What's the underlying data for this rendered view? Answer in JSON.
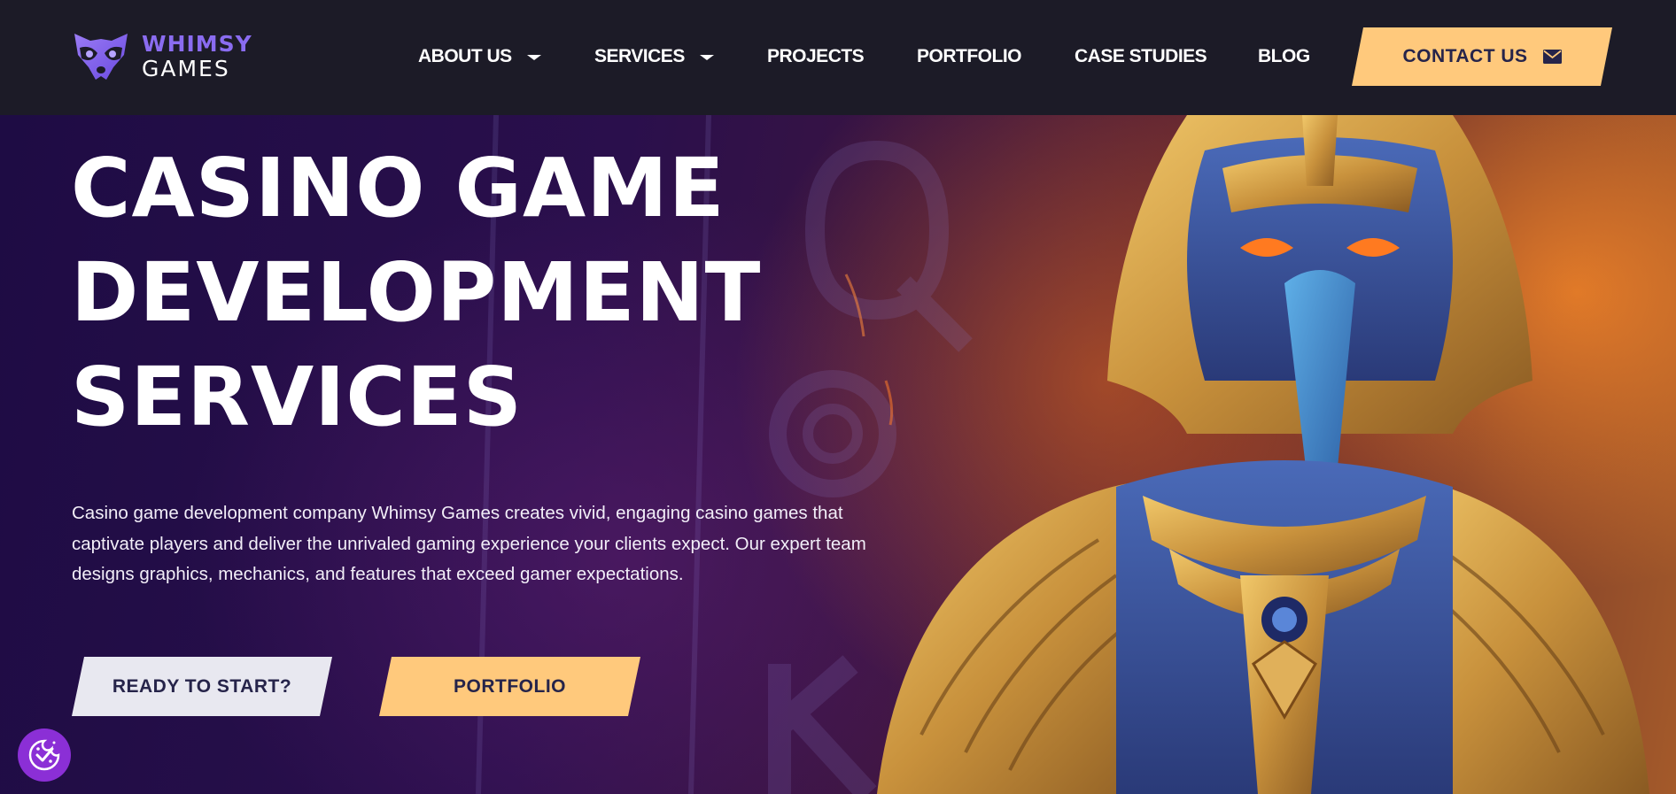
{
  "brand": {
    "logo_line1": "WHIMSY",
    "logo_line2": "GAMES",
    "logo_color": "#8a6cf0"
  },
  "nav": {
    "about": "ABOUT US",
    "services": "SERVICES",
    "projects": "PROJECTS",
    "portfolio": "PORTFOLIO",
    "case_studies": "CASE STUDIES",
    "blog": "BLOG",
    "contact": "CONTACT US",
    "contact_icon": "envelope-icon"
  },
  "hero": {
    "title_line1": "CASINO GAME",
    "title_line2": "DEVELOPMENT",
    "title_line3": "SERVICES",
    "description": "Casino game development company Whimsy Games creates vivid, engaging casino games that captivate players and deliver the unrivaled gaming experience your clients expect. Our expert team designs graphics, mechanics, and features that exceed gamer expectations.",
    "cta_primary": "READY TO START?",
    "cta_secondary": "PORTFOLIO"
  },
  "cookie_widget": {
    "icon": "cookie-consent-icon"
  },
  "colors": {
    "header_bg": "#1c1b27",
    "accent": "#ffc97c",
    "button_text": "#26244a",
    "light_button": "#e8e8f0",
    "cookie_bg": "#8b2fd6"
  }
}
